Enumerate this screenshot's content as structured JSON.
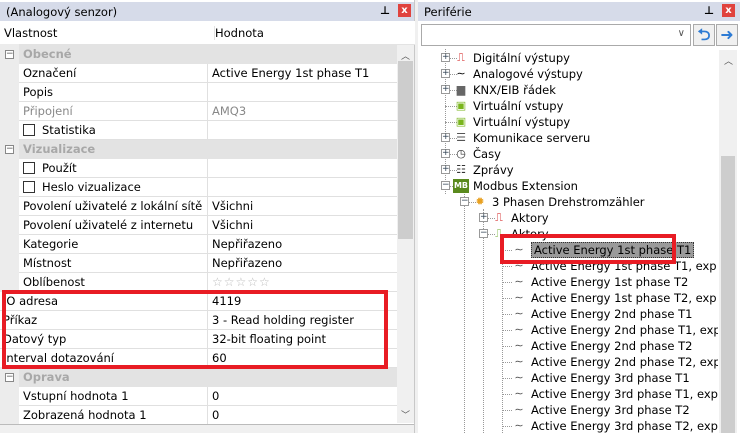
{
  "left_panel": {
    "title": "(Analogový senzor)",
    "pin_icon": "pin-icon",
    "close_icon": "close-icon",
    "columns": [
      "Vlastnost",
      "Hodnota"
    ],
    "rows": [
      {
        "type": "category",
        "name": "Obecné",
        "expanded": true
      },
      {
        "name": "Označení",
        "value": "Active Energy 1st phase T1"
      },
      {
        "name": "Popis",
        "value": ""
      },
      {
        "name": "Připojení",
        "value": "AMQ3",
        "disabled": true
      },
      {
        "name": "Statistika",
        "value": "",
        "checkbox": true,
        "checked": false
      },
      {
        "type": "category",
        "name": "Vizualizace",
        "expanded": true
      },
      {
        "name": "Použít",
        "value": "",
        "checkbox": true,
        "checked": false
      },
      {
        "name": "Heslo vizualizace",
        "value": "",
        "checkbox": true,
        "checked": false
      },
      {
        "name": "Povolení uživatelé z lokální sítě",
        "value": "Všichni"
      },
      {
        "name": "Povolení uživatelé z internetu",
        "value": "Všichni"
      },
      {
        "name": "Kategorie",
        "value": "Nepřiřazeno"
      },
      {
        "name": "Místnost",
        "value": "Nepřiřazeno"
      },
      {
        "name": "Oblíbenost",
        "value": "☆☆☆☆☆",
        "stars": 0
      },
      {
        "name": "IO adresa",
        "value": "4119",
        "noindent": true
      },
      {
        "name": "Příkaz",
        "value": "3 - Read holding register",
        "noindent": true
      },
      {
        "name": "Datový typ",
        "value": "32-bit floating point",
        "noindent": true
      },
      {
        "name": "Interval dotazování",
        "value": "60",
        "noindent": true
      },
      {
        "type": "category",
        "name": "Oprava",
        "expanded": true
      },
      {
        "name": "Vstupní hodnota 1",
        "value": "0"
      },
      {
        "name": "Zobrazená hodnota 1",
        "value": "0"
      }
    ]
  },
  "right_panel": {
    "title": "Periférie",
    "combo_value": "",
    "back_icon": "arrow-left-icon",
    "forward_icon": "arrow-right-icon",
    "tree": [
      {
        "label": "Digitální výstupy",
        "level": 0,
        "expander": "+",
        "icon": "digital-output-icon"
      },
      {
        "label": "Analogové výstupy",
        "level": 0,
        "expander": "+",
        "icon": "analog-output-icon"
      },
      {
        "label": "KNX/EIB řádek",
        "level": 0,
        "expander": "+",
        "icon": "knx-icon"
      },
      {
        "label": "Virtuální vstupy",
        "level": 0,
        "expander": "",
        "icon": "virtual-input-icon"
      },
      {
        "label": "Virtuální výstupy",
        "level": 0,
        "expander": "",
        "icon": "virtual-output-icon"
      },
      {
        "label": "Komunikace serveru",
        "level": 0,
        "expander": "+",
        "icon": "server-icon"
      },
      {
        "label": "Časy",
        "level": 0,
        "expander": "+",
        "icon": "calendar-clock-icon"
      },
      {
        "label": "Zprávy",
        "level": 0,
        "expander": "+",
        "icon": "messages-icon"
      },
      {
        "label": "Modbus Extension",
        "level": 0,
        "expander": "−",
        "icon": "modbus-icon"
      },
      {
        "label": "3 Phasen Drehstromzähler",
        "level": 1,
        "expander": "−",
        "icon": "device-icon"
      },
      {
        "label": "Aktory",
        "level": 2,
        "expander": "+",
        "icon": "actuator-icon"
      },
      {
        "label": "Aktory",
        "level": 2,
        "expander": "−",
        "icon": "sensor-group-icon"
      },
      {
        "label": "Active Energy 1st phase T1",
        "level": 3,
        "icon": "analog-sensor-icon",
        "selected": true
      },
      {
        "label": "Active Energy 1st phase T1, exp",
        "level": 3,
        "icon": "analog-sensor-icon"
      },
      {
        "label": "Active Energy 1st phase T2",
        "level": 3,
        "icon": "analog-sensor-icon"
      },
      {
        "label": "Active Energy 1st phase T2, exp",
        "level": 3,
        "icon": "analog-sensor-icon"
      },
      {
        "label": "Active Energy 2nd phase T1",
        "level": 3,
        "icon": "analog-sensor-icon"
      },
      {
        "label": "Active Energy 2nd phase T1, exp",
        "level": 3,
        "icon": "analog-sensor-icon"
      },
      {
        "label": "Active Energy 2nd phase T2",
        "level": 3,
        "icon": "analog-sensor-icon"
      },
      {
        "label": "Active Energy 2nd phase T2, exp",
        "level": 3,
        "icon": "analog-sensor-icon"
      },
      {
        "label": "Active Energy 3rd phase T1",
        "level": 3,
        "icon": "analog-sensor-icon"
      },
      {
        "label": "Active Energy 3rd phase T1, exp",
        "level": 3,
        "icon": "analog-sensor-icon"
      },
      {
        "label": "Active Energy 3rd phase T2",
        "level": 3,
        "icon": "analog-sensor-icon"
      },
      {
        "label": "Active Energy 3rd phase T2, exp",
        "level": 3,
        "icon": "analog-sensor-icon"
      }
    ]
  },
  "colors": {
    "highlight_box": "#e81c24",
    "title_bar": "#d6dbe9",
    "category_bg": "#e3e3e3",
    "nav_arrow": "#2d7bd4"
  }
}
